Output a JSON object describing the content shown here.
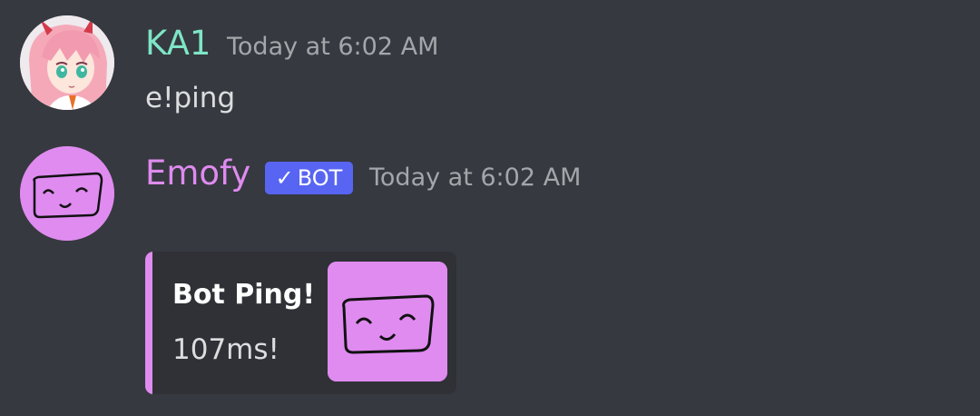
{
  "messages": [
    {
      "username": "KA1",
      "username_color": "#7ee5c6",
      "timestamp": "Today at 6:02 AM",
      "avatar": "anime-girl-avatar",
      "content": "e!ping"
    },
    {
      "username": "Emofy",
      "username_color": "#df8bf0",
      "timestamp": "Today at 6:02 AM",
      "avatar": "smiling-face-avatar",
      "bot_tag": {
        "check": "✓",
        "label": "BOT",
        "color": "#5865f2"
      },
      "embed": {
        "title": "Bot Ping!",
        "description": "107ms!",
        "accent_color": "#df8bf0",
        "thumbnail": "smiling-face-thumbnail"
      }
    }
  ],
  "colors": {
    "background": "#36393f",
    "embed_background": "#2f3136",
    "text": "#dcddde",
    "timestamp": "#a3a6aa"
  }
}
